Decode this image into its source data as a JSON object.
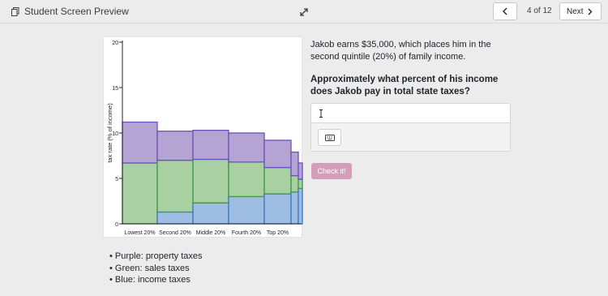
{
  "topbar": {
    "title": "Student Screen Preview",
    "page_indicator": "4 of 12",
    "next_label": "Next",
    "icons": [
      "copy-icon",
      "expand-icon",
      "chevron-left-icon",
      "chevron-right-icon"
    ]
  },
  "question": {
    "intro": "Jakob earns $35,000, which places him in the second quintile (20%) of family income.",
    "prompt": "Approximately what percent of his income does Jakob pay in total state taxes?",
    "answer_value": "",
    "check_label": "Check it!",
    "keyboard_icon": "keyboard-icon"
  },
  "legend_bullets": [
    "• Purple: property taxes",
    "• Green: sales taxes",
    "• Blue: income taxes"
  ],
  "colors": {
    "purple": "#b3a4d4",
    "green": "#a8d0a3",
    "blue": "#9dbde3",
    "check_button": "#d49dbc"
  },
  "chart_data": {
    "type": "bar",
    "stacked": true,
    "variable_width": true,
    "categories": [
      "Lowest 20%",
      "Second 20%",
      "Middle 20%",
      "Fourth 20%",
      "Top 20%",
      "",
      ""
    ],
    "series": [
      {
        "color": "#9dbde3",
        "values": [
          0.0,
          1.3,
          2.3,
          3.0,
          3.3,
          3.5,
          3.9
        ]
      },
      {
        "color": "#a8d0a3",
        "values": [
          6.7,
          5.7,
          4.8,
          3.8,
          2.9,
          1.8,
          1.0
        ]
      },
      {
        "color": "#b3a4d4",
        "values": [
          4.5,
          3.2,
          3.2,
          3.2,
          3.0,
          2.6,
          1.8
        ]
      }
    ],
    "ylabel": "tax rate (% of income)",
    "yticks": [
      0,
      5,
      10,
      15,
      20
    ],
    "ylim": [
      0,
      20
    ]
  }
}
